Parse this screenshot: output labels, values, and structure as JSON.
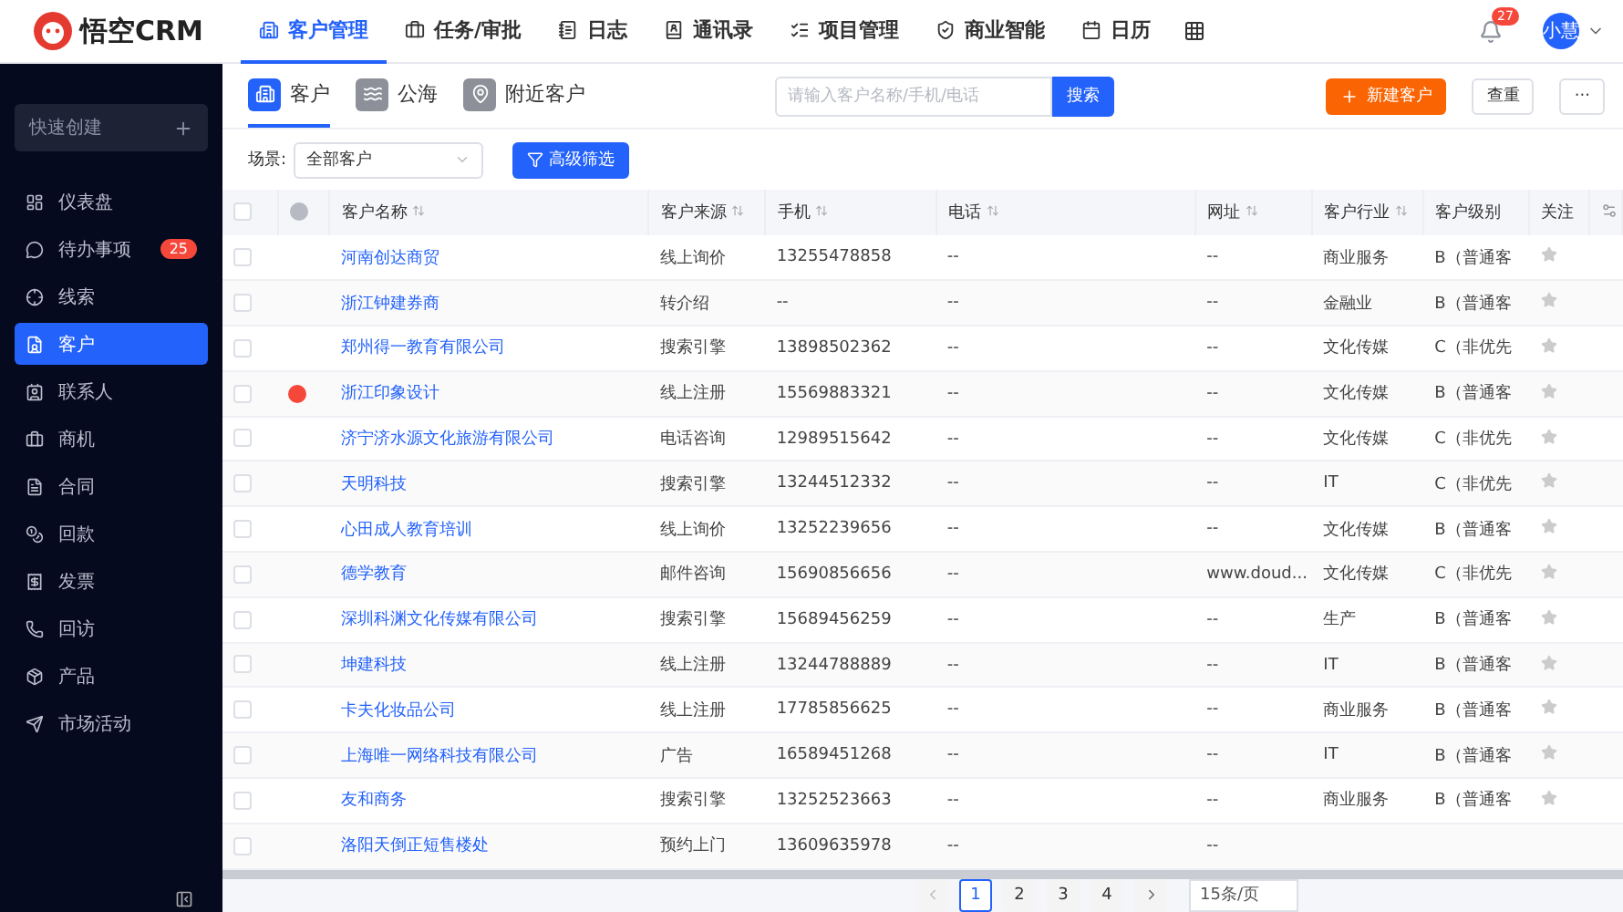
{
  "header": {
    "logo": "悟空CRM",
    "nav": [
      {
        "label": "客户管理",
        "selected": true
      },
      {
        "label": "任务/审批",
        "selected": false
      },
      {
        "label": "日志",
        "selected": false
      },
      {
        "label": "通讯录",
        "selected": false
      },
      {
        "label": "项目管理",
        "selected": false
      },
      {
        "label": "商业智能",
        "selected": false
      },
      {
        "label": "日历",
        "selected": false
      }
    ],
    "notification_count": "27",
    "avatar": "小慧"
  },
  "sidebar": {
    "quick_create": "快速创建",
    "items": [
      {
        "label": "仪表盘",
        "selected": false
      },
      {
        "label": "待办事项",
        "selected": false,
        "badge": "25"
      },
      {
        "label": "线索",
        "selected": false
      },
      {
        "label": "客户",
        "selected": true
      },
      {
        "label": "联系人",
        "selected": false
      },
      {
        "label": "商机",
        "selected": false
      },
      {
        "label": "合同",
        "selected": false
      },
      {
        "label": "回款",
        "selected": false
      },
      {
        "label": "发票",
        "selected": false
      },
      {
        "label": "回访",
        "selected": false
      },
      {
        "label": "产品",
        "selected": false
      },
      {
        "label": "市场活动",
        "selected": false
      }
    ]
  },
  "tabs": [
    {
      "label": "客户",
      "selected": true
    },
    {
      "label": "公海",
      "selected": false
    },
    {
      "label": "附近客户",
      "selected": false
    }
  ],
  "search": {
    "placeholder": "请输入客户名称/手机/电话",
    "button": "搜索"
  },
  "actions": {
    "create": "新建客户",
    "dedupe": "查重",
    "more": "···"
  },
  "filter": {
    "label": "场景:",
    "scene": "全部客户",
    "advanced": "高级筛选"
  },
  "table": {
    "all_checked": false,
    "columns": [
      "客户名称",
      "客户来源",
      "手机",
      "电话",
      "网址",
      "客户行业",
      "客户级别",
      "关注"
    ],
    "rows": [
      {
        "name": "河南创达商贸",
        "source": "线上询价",
        "mobile": "13255478858",
        "phone": "--",
        "website": "--",
        "industry": "商业服务",
        "level": "B（普通客",
        "alert": false,
        "checked": false,
        "followed": false
      },
      {
        "name": "浙江钟建券商",
        "source": "转介绍",
        "mobile": "--",
        "phone": "--",
        "website": "--",
        "industry": "金融业",
        "level": "B（普通客",
        "alert": false,
        "checked": false,
        "followed": false
      },
      {
        "name": "郑州得一教育有限公司",
        "source": "搜索引擎",
        "mobile": "13898502362",
        "phone": "--",
        "website": "--",
        "industry": "文化传媒",
        "level": "C（非优先",
        "alert": false,
        "checked": false,
        "followed": false
      },
      {
        "name": "浙江印象设计",
        "source": "线上注册",
        "mobile": "15569883321",
        "phone": "--",
        "website": "--",
        "industry": "文化传媒",
        "level": "B（普通客",
        "alert": true,
        "checked": false,
        "followed": false
      },
      {
        "name": "济宁济水源文化旅游有限公司",
        "source": "电话咨询",
        "mobile": "12989515642",
        "phone": "--",
        "website": "--",
        "industry": "文化传媒",
        "level": "C（非优先",
        "alert": false,
        "checked": false,
        "followed": false
      },
      {
        "name": "天明科技",
        "source": "搜索引擎",
        "mobile": "13244512332",
        "phone": "--",
        "website": "--",
        "industry": "IT",
        "level": "C（非优先",
        "alert": false,
        "checked": false,
        "followed": false
      },
      {
        "name": "心田成人教育培训",
        "source": "线上询价",
        "mobile": "13252239656",
        "phone": "--",
        "website": "--",
        "industry": "文化传媒",
        "level": "B（普通客",
        "alert": false,
        "checked": false,
        "followed": false
      },
      {
        "name": "德学教育",
        "source": "邮件咨询",
        "mobile": "15690856656",
        "phone": "--",
        "website": "www.doud...",
        "industry": "文化传媒",
        "level": "C（非优先",
        "alert": false,
        "checked": false,
        "followed": false
      },
      {
        "name": "深圳科渊文化传媒有限公司",
        "source": "搜索引擎",
        "mobile": "15689456259",
        "phone": "--",
        "website": "--",
        "industry": "生产",
        "level": "B（普通客",
        "alert": false,
        "checked": false,
        "followed": false
      },
      {
        "name": "坤建科技",
        "source": "线上注册",
        "mobile": "13244788889",
        "phone": "--",
        "website": "--",
        "industry": "IT",
        "level": "B（普通客",
        "alert": false,
        "checked": false,
        "followed": false
      },
      {
        "name": "卡夫化妆品公司",
        "source": "线上注册",
        "mobile": "17785856625",
        "phone": "--",
        "website": "--",
        "industry": "商业服务",
        "level": "B（普通客",
        "alert": false,
        "checked": false,
        "followed": false
      },
      {
        "name": "上海唯一网络科技有限公司",
        "source": "广告",
        "mobile": "16589451268",
        "phone": "--",
        "website": "--",
        "industry": "IT",
        "level": "B（普通客",
        "alert": false,
        "checked": false,
        "followed": false
      },
      {
        "name": "友和商务",
        "source": "搜索引擎",
        "mobile": "13252523663",
        "phone": "--",
        "website": "--",
        "industry": "商业服务",
        "level": "B（普通客",
        "alert": false,
        "checked": false,
        "followed": false
      },
      {
        "name": "洛阳天倒正短售楼处",
        "source": "预约上门",
        "mobile": "13609635978",
        "phone": "--",
        "website": "--",
        "alert": false,
        "checked": false
      }
    ]
  },
  "pagination": {
    "pages": [
      {
        "label": "1",
        "selected": true
      },
      {
        "label": "2",
        "selected": false
      },
      {
        "label": "3",
        "selected": false
      },
      {
        "label": "4",
        "selected": false
      }
    ],
    "page_size": "15条/页"
  }
}
